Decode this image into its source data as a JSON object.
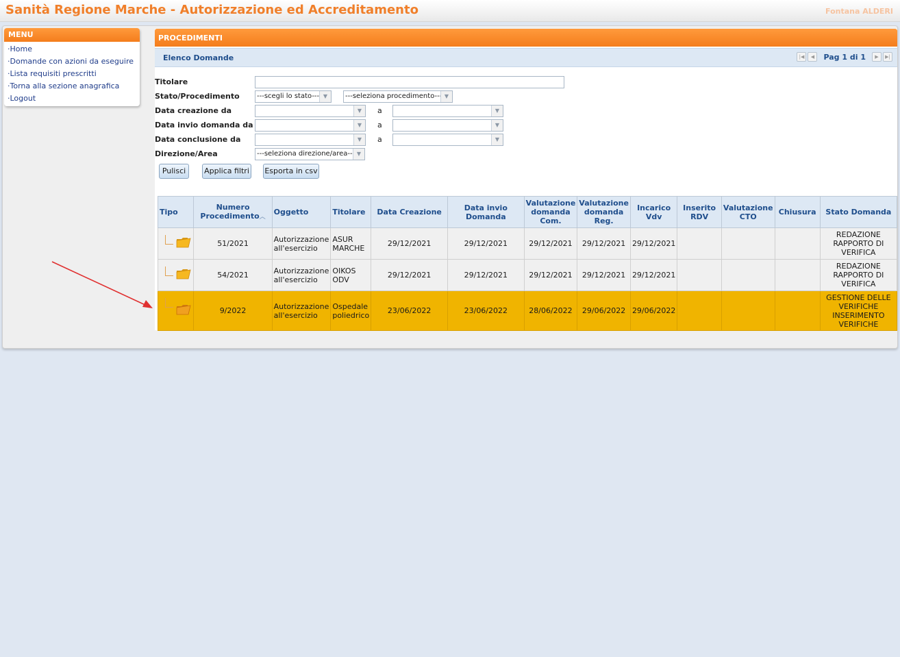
{
  "app": {
    "title": "Sanità Regione Marche - Autorizzazione ed Accreditamento",
    "user": "Fontana  ALDERI"
  },
  "menu": {
    "header": "MENU",
    "items": [
      {
        "label": "·Home"
      },
      {
        "label": "·Domande con azioni da eseguire"
      },
      {
        "label": "·Lista requisiti prescritti"
      },
      {
        "label": "·Torna alla sezione anagrafica"
      },
      {
        "label": "·Logout"
      }
    ]
  },
  "main": {
    "section_title": "PROCEDIMENTI",
    "list_title": "Elenco Domande",
    "pager": {
      "label": "Pag 1 di 1"
    }
  },
  "filters": {
    "titolare_label": "Titolare",
    "titolare_value": "",
    "stato_label": "Stato/Procedimento",
    "stato_select": "---scegli lo stato---",
    "procedimento_select": "---seleziona procedimento---",
    "data_creazione_label": "Data creazione da",
    "data_invio_label": "Data invio domanda da",
    "data_conclusione_label": "Data conclusione da",
    "a_label": "a",
    "direzione_label": "Direzione/Area",
    "direzione_select": "---seleziona direzione/area---",
    "buttons": {
      "clear": "Pulisci",
      "apply": "Applica filtri",
      "export": "Esporta in csv"
    }
  },
  "table": {
    "columns": [
      "Tipo",
      "Numero Procedimento",
      "Oggetto",
      "Titolare",
      "Data Creazione",
      "Data invio Domanda",
      "Valutazione domanda Com.",
      "Valutazione domanda Reg.",
      "Incarico Vdv",
      "Inserito RDV",
      "Valutazione CTO",
      "Chiusura",
      "Stato Domanda"
    ],
    "rows": [
      {
        "numero": "51/2021",
        "oggetto": "Autorizzazione all'esercizio",
        "titolare": "ASUR MARCHE",
        "data_creazione": "29/12/2021",
        "data_invio": "29/12/2021",
        "val_com": "29/12/2021",
        "val_reg": "29/12/2021",
        "incarico_vdv": "29/12/2021",
        "inserito_rdv": "",
        "val_cto": "",
        "chiusura": "",
        "stato": "REDAZIONE RAPPORTO DI VERIFICA"
      },
      {
        "numero": "54/2021",
        "oggetto": "Autorizzazione all'esercizio",
        "titolare": "OIKOS ODV",
        "data_creazione": "29/12/2021",
        "data_invio": "29/12/2021",
        "val_com": "29/12/2021",
        "val_reg": "29/12/2021",
        "incarico_vdv": "29/12/2021",
        "inserito_rdv": "",
        "val_cto": "",
        "chiusura": "",
        "stato": "REDAZIONE RAPPORTO DI VERIFICA"
      },
      {
        "numero": "9/2022",
        "oggetto": "Autorizzazione all'esercizio",
        "titolare": "Ospedale poliedrico",
        "data_creazione": "23/06/2022",
        "data_invio": "23/06/2022",
        "val_com": "28/06/2022",
        "val_reg": "29/06/2022",
        "incarico_vdv": "29/06/2022",
        "inserito_rdv": "",
        "val_cto": "",
        "chiusura": "",
        "stato": "GESTIONE DELLE VERIFICHE INSERIMENTO VERIFICHE"
      }
    ]
  },
  "icons": {
    "folder": "folder-icon",
    "sort": "sort-asc-icon",
    "annotation": "red-arrow-annotation"
  },
  "colors": {
    "brand_orange": "#f47d1c",
    "selected_row": "#f0b400",
    "header_blue": "#1f4e8c",
    "arrow": "#e03030"
  }
}
